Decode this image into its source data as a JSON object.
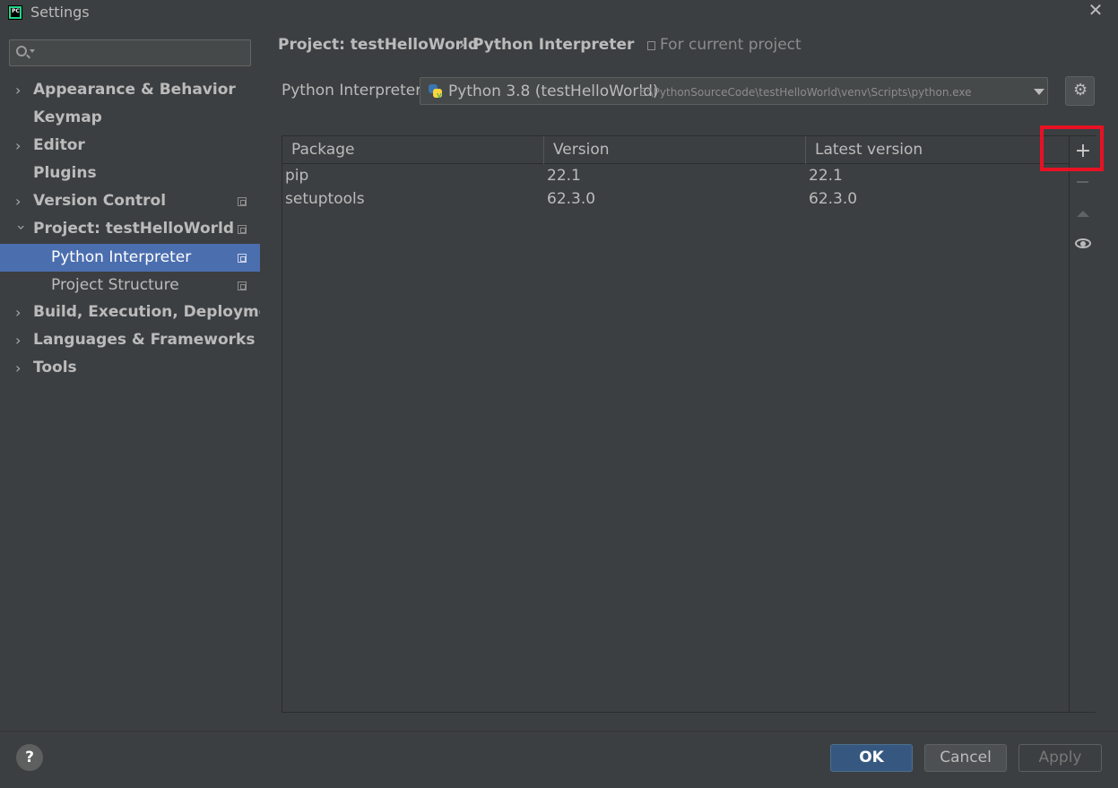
{
  "window": {
    "title": "Settings",
    "close_glyph": "✕",
    "app_icon": "pycharm-icon"
  },
  "sidebar": {
    "search_placeholder": "",
    "items": [
      {
        "label": "Appearance & Behavior",
        "expandable": true
      },
      {
        "label": "Keymap",
        "expandable": false
      },
      {
        "label": "Editor",
        "expandable": true
      },
      {
        "label": "Plugins",
        "expandable": false
      },
      {
        "label": "Version Control",
        "expandable": true
      },
      {
        "label": "Project: testHelloWorld",
        "expandable": true,
        "expanded": true
      },
      {
        "label": "Python Interpreter",
        "selected": true
      },
      {
        "label": "Project Structure"
      },
      {
        "label": "Build, Execution, Deployment",
        "expandable": true
      },
      {
        "label": "Languages & Frameworks",
        "expandable": true
      },
      {
        "label": "Tools",
        "expandable": true
      }
    ]
  },
  "main": {
    "breadcrumb": {
      "project": "Project: testHelloWorld",
      "separator": "›",
      "page": "Python Interpreter",
      "scope": "For current project"
    },
    "interpreter": {
      "label": "Python Interpreter:",
      "name": "Python 3.8 (testHelloWorld)",
      "path": "E:\\PythonSourceCode\\testHelloWorld\\venv\\Scripts\\python.exe"
    },
    "table": {
      "columns": [
        "Package",
        "Version",
        "Latest version"
      ],
      "rows": [
        {
          "package": "pip",
          "version": "22.1",
          "latest": "22.1"
        },
        {
          "package": "setuptools",
          "version": "62.3.0",
          "latest": "62.3.0"
        }
      ]
    },
    "toolbar": {
      "add": "+",
      "remove": "−"
    }
  },
  "footer": {
    "help": "?",
    "ok": "OK",
    "cancel": "Cancel",
    "apply": "Apply"
  },
  "colors": {
    "background": "#3c3f41",
    "selection": "#4b6eaf",
    "ok_button": "#365880",
    "highlight": "#e81123"
  }
}
